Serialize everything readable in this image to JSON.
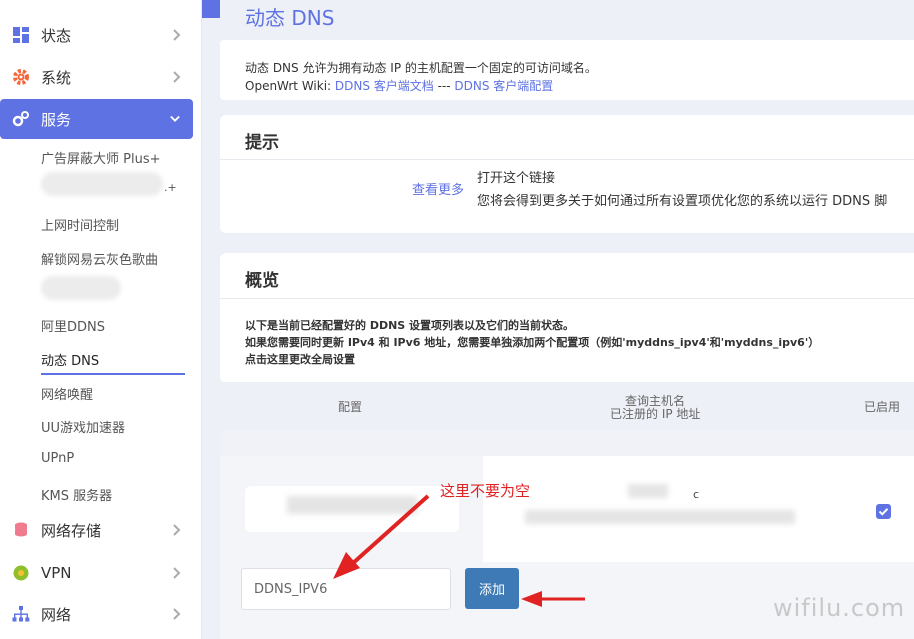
{
  "sidebar": {
    "items": [
      {
        "label": "状态",
        "icon": "dashboard-icon",
        "color": "#5e72e4"
      },
      {
        "label": "系统",
        "icon": "gear-icon",
        "color": "#f5663c"
      },
      {
        "label": "服务",
        "icon": "services-icon",
        "color": "#ffffff"
      },
      {
        "label": "网络存储",
        "icon": "database-icon",
        "color": "#f07a8e"
      },
      {
        "label": "VPN",
        "icon": "vpn-icon",
        "color": "#8fbf2c"
      },
      {
        "label": "网络",
        "icon": "network-icon",
        "color": "#5e72e4"
      }
    ],
    "sub_items": [
      "广告屏蔽大师 Plus+",
      ".+",
      "上网时间控制",
      "解锁网易云灰色歌曲",
      "阿里DDNS",
      "动态 DNS",
      "网络唤醒",
      "UU游戏加速器",
      "UPnP",
      "KMS 服务器"
    ],
    "accent": "#5e72e4"
  },
  "page": {
    "title": "动态 DNS",
    "desc": "动态 DNS 允许为拥有动态 IP 的主机配置一个固定的可访问域名。",
    "wiki_prefix": "OpenWrt Wiki: ",
    "wiki_link1": "DDNS 客户端文档",
    "wiki_sep": " --- ",
    "wiki_link2": "DDNS 客户端配置"
  },
  "hint": {
    "title": "提示",
    "label": "查看更多",
    "line1": "打开这个链接",
    "line2": "您将会得到更多关于如何通过所有设置项优化您的系统以运行 DDNS 脚"
  },
  "overview": {
    "title": "概览",
    "line1": "以下是当前已经配置好的 DDNS 设置项列表以及它们的当前状态。",
    "line2": "如果您需要同时更新 IPv4 和 IPv6 地址，您需要单独添加两个配置项（例如'myddns_ipv4'和'myddns_ipv6'）",
    "link": "点击这里更改全局设置",
    "col_config": "配置",
    "col_host1": "查询主机名",
    "col_host2": "已注册的 IP 地址",
    "col_enabled": "已启用",
    "row_mark": "c",
    "input_value": "DDNS_IPV6",
    "add_label": "添加"
  },
  "annotation": "这里不要为空",
  "watermark": "wifilu.com"
}
